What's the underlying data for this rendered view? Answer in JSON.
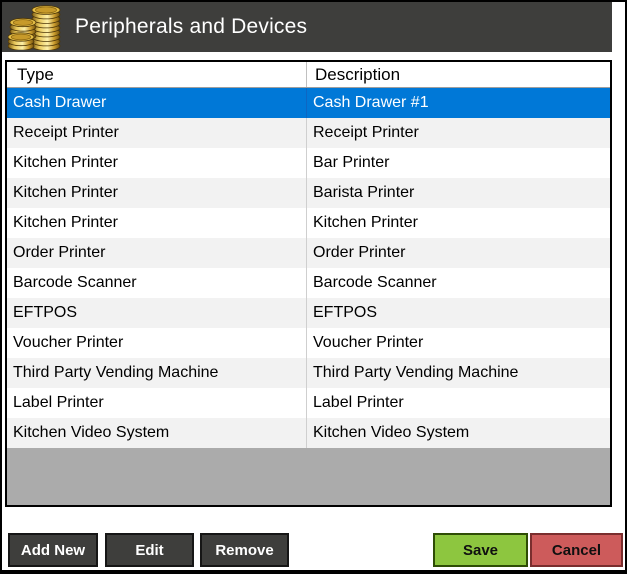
{
  "window": {
    "title": "Peripherals and Devices"
  },
  "table": {
    "columns": {
      "type": "Type",
      "description": "Description"
    },
    "rows": [
      {
        "type": "Cash Drawer",
        "description": "Cash Drawer #1",
        "selected": true
      },
      {
        "type": "Receipt Printer",
        "description": "Receipt Printer"
      },
      {
        "type": "Kitchen Printer",
        "description": "Bar Printer"
      },
      {
        "type": "Kitchen Printer",
        "description": "Barista Printer"
      },
      {
        "type": "Kitchen Printer",
        "description": "Kitchen Printer"
      },
      {
        "type": "Order Printer",
        "description": "Order Printer"
      },
      {
        "type": "Barcode Scanner",
        "description": "Barcode Scanner"
      },
      {
        "type": "EFTPOS",
        "description": "EFTPOS"
      },
      {
        "type": "Voucher Printer",
        "description": "Voucher Printer"
      },
      {
        "type": "Third Party Vending Machine",
        "description": "Third Party Vending Machine"
      },
      {
        "type": "Label Printer",
        "description": "Label Printer"
      },
      {
        "type": "Kitchen Video System",
        "description": "Kitchen Video System"
      }
    ]
  },
  "buttons": {
    "add_new": "Add New",
    "edit": "Edit",
    "remove": "Remove",
    "save": "Save",
    "cancel": "Cancel"
  },
  "icons": {
    "header_icon": "coins-icon"
  },
  "colors": {
    "titlebar_bg": "#3e3e3c",
    "selection_blue": "#0078d7",
    "row_alt_gray": "#f2f2f2",
    "empty_area_gray": "#ababab",
    "save_green": "#8dc63f",
    "cancel_red": "#cd5b5b",
    "dark_button": "#3e3e3c"
  }
}
